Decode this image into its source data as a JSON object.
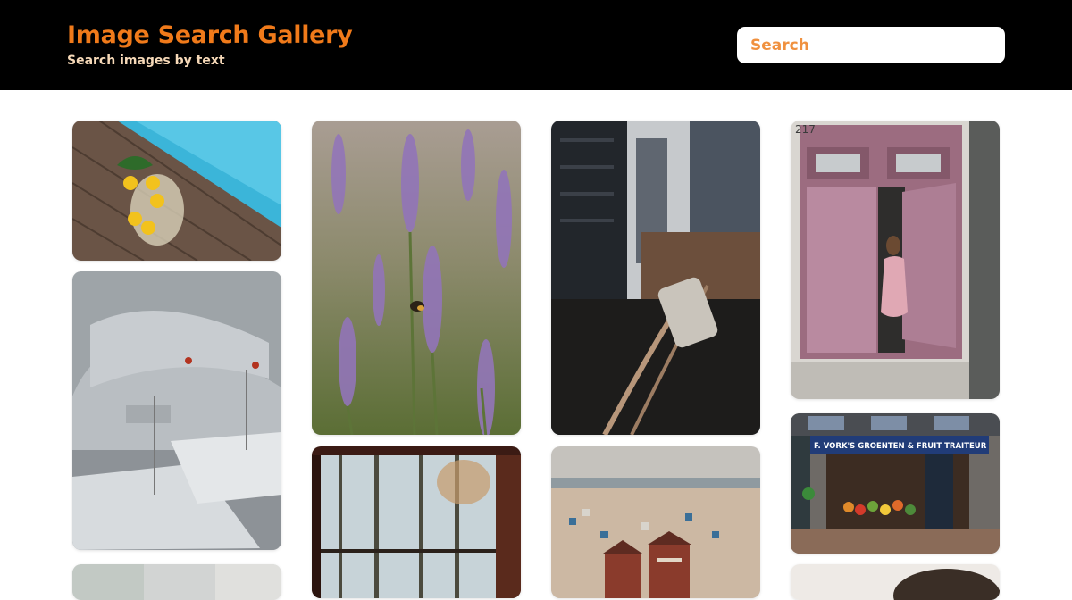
{
  "header": {
    "title": "Image Search Gallery",
    "subtitle": "Search images by text"
  },
  "search": {
    "placeholder": "Search"
  },
  "gallery": {
    "columns": [
      {
        "items": [
          {
            "icon": "lemons-poolside-image"
          },
          {
            "icon": "cafe-interior-image"
          },
          {
            "icon": "partial-image"
          }
        ]
      },
      {
        "items": [
          {
            "icon": "lavender-bee-image"
          },
          {
            "icon": "forest-window-film-image"
          }
        ]
      },
      {
        "items": [
          {
            "icon": "city-elevated-train-image"
          },
          {
            "icon": "beach-huts-image"
          }
        ]
      },
      {
        "items": [
          {
            "icon": "pink-door-woman-image",
            "door_number": "217"
          },
          {
            "icon": "fruit-shop-storefront-image",
            "shop_sign": "F. VORK'S GROENTEN & FRUIT TRAITEUR"
          },
          {
            "icon": "partial-portrait-image"
          }
        ]
      }
    ]
  },
  "colors": {
    "header_bg": "#000000",
    "accent": "#f07a1a",
    "subtitle": "#f6d9b8"
  }
}
